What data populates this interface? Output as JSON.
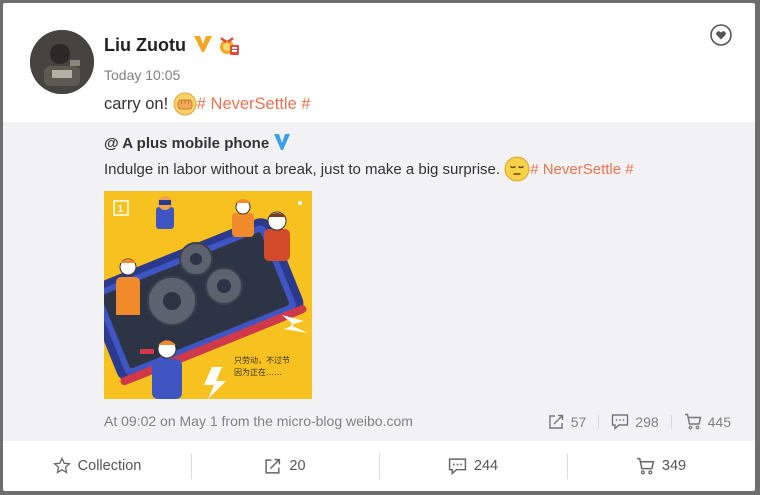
{
  "post": {
    "username": "Liu Zuotu",
    "time": "Today 10:05",
    "text": "carry on! ",
    "topic": "# NeverSettle #"
  },
  "repost": {
    "user": "@ A plus mobile phone",
    "text": "Indulge in labor without a break, just to make a big surprise. ",
    "topic": "# NeverSettle #",
    "image_caption_line1": "只劳动，不过节",
    "image_caption_line2": "因为正在……",
    "meta": "At 09:02 on May 1 from the micro-blog weibo.com",
    "repost_count": "57",
    "comment_count": "298",
    "like_count": "445"
  },
  "footer": {
    "collection_label": "Collection",
    "repost_count": "20",
    "comment_count": "244",
    "like_count": "349"
  },
  "colors": {
    "topic": "#eb7350",
    "verified_gold": "#f5a623",
    "verified_blue": "#3aa0e8",
    "image_bg": "#f7c21f"
  }
}
